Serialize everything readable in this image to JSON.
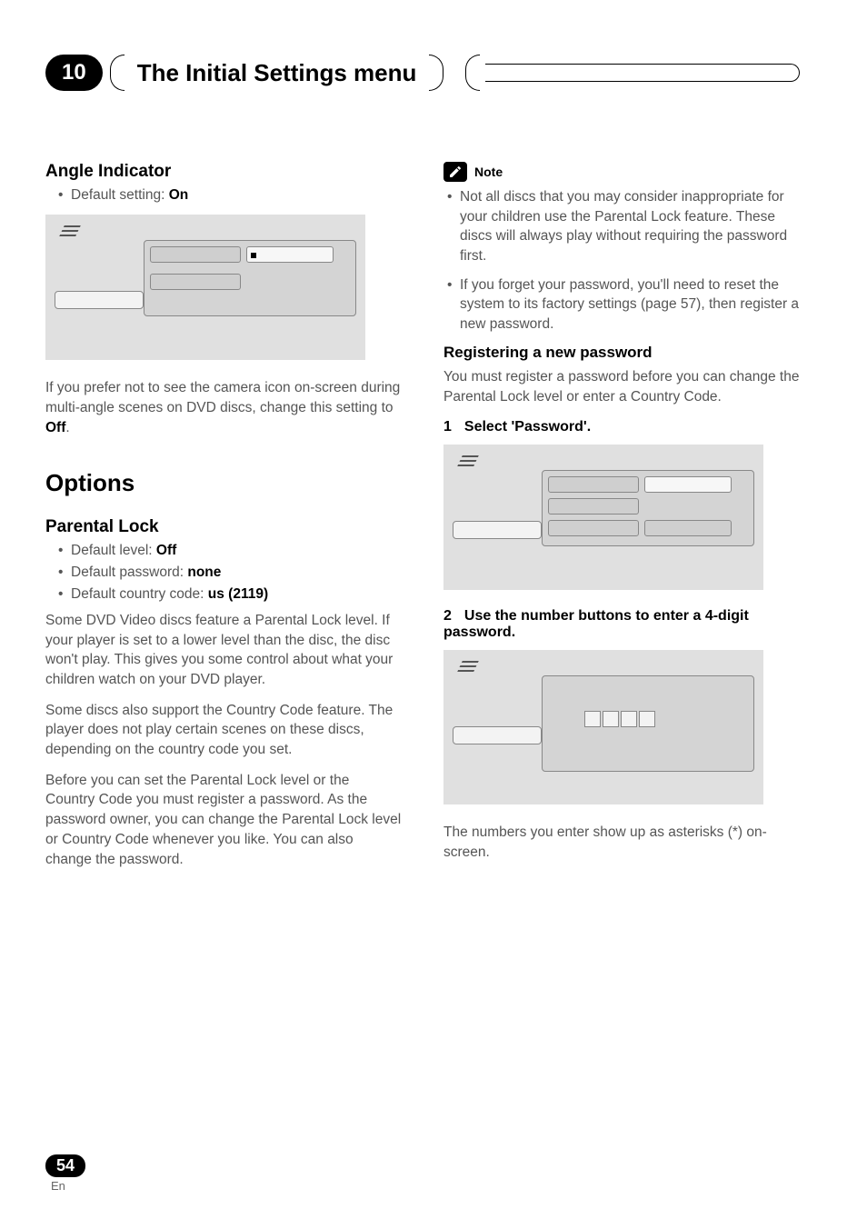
{
  "header": {
    "chapter_number": "10",
    "title": "The Initial Settings menu"
  },
  "left": {
    "angle": {
      "heading": "Angle Indicator",
      "default_label": "Default setting: ",
      "default_value": "On",
      "paragraph_pre": "If you prefer not to see the camera icon on-screen during multi-angle scenes on DVD discs, change this setting to ",
      "paragraph_bold": "Off",
      "paragraph_post": "."
    },
    "options_heading": "Options",
    "parental": {
      "heading": "Parental Lock",
      "b1_label": "Default level: ",
      "b1_value": "Off",
      "b2_label": "Default password: ",
      "b2_value": "none",
      "b3_label": "Default country code: ",
      "b3_value": "us (2119)",
      "p1": "Some DVD Video discs feature a Parental Lock level. If your player is set to a lower level than the disc, the disc won't play. This gives you some control about what your children watch on your DVD player.",
      "p2": "Some discs also support the Country Code feature. The player does not play certain scenes on these discs, depending on the country code you set.",
      "p3": "Before you can set the Parental Lock level or the Country Code you must register a password. As the password owner, you can change the Parental Lock level or Country Code whenever you like. You can also change the password."
    }
  },
  "right": {
    "note_label": "Note",
    "note_b1": "Not all discs that you may consider inappropriate for your children use the Parental Lock feature. These discs will always play without requiring the password first.",
    "note_b2": "If you forget your password, you'll need to reset the system to its factory settings (page 57), then register a new password.",
    "register": {
      "heading": "Registering a new password",
      "intro": "You must register a password before you can change the Parental Lock level or enter a Country Code.",
      "step1_num": "1",
      "step1_text": "Select 'Password'.",
      "step2_num": "2",
      "step2_text": "Use the number buttons to enter a 4-digit password.",
      "after": "The numbers you enter show up as asterisks (*) on-screen."
    }
  },
  "footer": {
    "page": "54",
    "lang": "En"
  }
}
